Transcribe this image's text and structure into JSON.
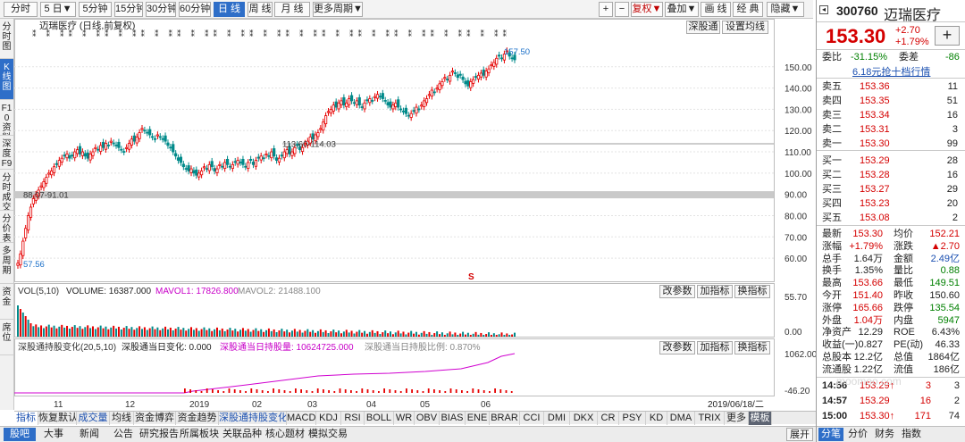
{
  "toolbar": {
    "periods": [
      "分时",
      "5 日▼",
      "5分钟",
      "15分钟",
      "30分钟",
      "60分钟",
      "日 线",
      "周 线",
      "月 线",
      "更多周期▼"
    ],
    "active_period": "日 线",
    "right_buttons": [
      "+",
      "−",
      "复权▼",
      "叠加▼",
      "画 线",
      "经 典",
      "隐藏▼"
    ]
  },
  "left_tabs": [
    "分时图",
    "K线图",
    "F10资料",
    "深度F9",
    "分时成交",
    "分价表",
    "多周期",
    "资金",
    "席位"
  ],
  "chart_header": {
    "title": "迈瑞医疗 (日线,前复权)",
    "sgt_btn": "深股通",
    "ma_btn": "设置均线"
  },
  "chart_data": [
    {
      "type": "candlestick",
      "title": "迈瑞医疗 (日线,前复权)",
      "y_ticks": [
        "150.00",
        "140.00",
        "130.00",
        "120.00",
        "110.00",
        "100.00",
        "90.00",
        "80.00",
        "70.00",
        "60.00"
      ],
      "ylim": [
        55,
        160
      ],
      "x_ticks": [
        "11",
        "12",
        "2019",
        "02",
        "03",
        "04",
        "05",
        "06"
      ],
      "annotations": [
        {
          "text": "157.50",
          "value": 157.5
        },
        {
          "text": "113.60-114.03",
          "value": 114
        },
        {
          "text": "88.07-91.01",
          "value": 90
        },
        {
          "text": "57.56",
          "value": 57.56
        }
      ],
      "close_approx": [
        57.6,
        62,
        68,
        74,
        80,
        84,
        88,
        90,
        92,
        94,
        96,
        98,
        100,
        101,
        103,
        104,
        106,
        107,
        108,
        109,
        107,
        108,
        110,
        111,
        109,
        110,
        108,
        107,
        109,
        110,
        112,
        111,
        113,
        112,
        114,
        113,
        115,
        114,
        113,
        112,
        111,
        110,
        112,
        114,
        116,
        115,
        117,
        119,
        121,
        120,
        119,
        118,
        117,
        116,
        118,
        117,
        116,
        115,
        113,
        112,
        110,
        108,
        106,
        105,
        103,
        102,
        101,
        102,
        100,
        99,
        100,
        101,
        103,
        102,
        104,
        103,
        101,
        102,
        104,
        103,
        105,
        104,
        103,
        104,
        105,
        106,
        105,
        104,
        103,
        105,
        106,
        104,
        106,
        107,
        108,
        107,
        109,
        108,
        110,
        108,
        106,
        107,
        108,
        110,
        111,
        109,
        110,
        112,
        113,
        111,
        112,
        114,
        115,
        117,
        116,
        118,
        119,
        121,
        124,
        127,
        129,
        130,
        132,
        131,
        133,
        134,
        132,
        133,
        135,
        134,
        133,
        134,
        132,
        131,
        133,
        134,
        135,
        134,
        136,
        137,
        136,
        135,
        134,
        132,
        131,
        132,
        133,
        131,
        130,
        129,
        128,
        127,
        128,
        129,
        131,
        130,
        132,
        134,
        135,
        137,
        139,
        138,
        140,
        142,
        143,
        145,
        144,
        146,
        148,
        147,
        145,
        146,
        144,
        142,
        141,
        143,
        144,
        145,
        146,
        147,
        146,
        148,
        149,
        151,
        152,
        154,
        155,
        154,
        156,
        157.5,
        155,
        154,
        153.3
      ]
    },
    {
      "type": "bar",
      "title": "VOL(5,10)",
      "legend": [
        "VOLUME: 16387.000",
        "MAVOL1: 17826.800",
        "MAVOL2: 21488.100"
      ],
      "y_ticks": [
        "55.70",
        "0.00"
      ],
      "ylim": [
        0,
        60
      ]
    },
    {
      "type": "line",
      "title": "深股通持股变化(20,5,10)",
      "legend": [
        "深股通当日变化: 0.000",
        "深股通当日持股量: 10624725.000",
        "深股通当日持股比例: 0.870%"
      ],
      "y_ticks": [
        "1062.00",
        "-46.20"
      ],
      "ylim": [
        -46.2,
        1062
      ]
    }
  ],
  "vol_buttons": [
    "改参数",
    "加指标",
    "换指标"
  ],
  "sgt_buttons": [
    "改参数",
    "加指标",
    "换指标"
  ],
  "date_label": "2019/06/18/二",
  "s_marker": "S",
  "bottom_tabs": [
    "指标",
    "恢复默认",
    "成交量",
    "均线",
    "资金博弈",
    "资金趋势",
    "深股通持股变化",
    "MACD",
    "KDJ",
    "RSI",
    "BOLL",
    "WR",
    "OBV",
    "BIAS",
    "ENE",
    "BRAR",
    "CCI",
    "DMI",
    "DKX",
    "CR",
    "PSY",
    "KD",
    "DMA",
    "TRIX",
    "更多",
    "模板"
  ],
  "bottom_bar": [
    "股吧",
    "大事",
    "新闻",
    "公告",
    "研究报告",
    "所属板块",
    "关联品种",
    "核心题材",
    "模拟交易"
  ],
  "expand_btn": "展开",
  "quote": {
    "code": "300760",
    "name": "迈瑞医疗",
    "price": "153.30",
    "change": "+2.70",
    "change_pct": "+1.79%",
    "weibi_label": "委比",
    "weibi": "-31.15%",
    "weicha_label": "委差",
    "weicha": "-86",
    "promo": "6.18元抢十档行情",
    "sell": [
      {
        "label": "卖五",
        "price": "153.36",
        "vol": "11"
      },
      {
        "label": "卖四",
        "price": "153.35",
        "vol": "51"
      },
      {
        "label": "卖三",
        "price": "153.34",
        "vol": "16"
      },
      {
        "label": "卖二",
        "price": "153.31",
        "vol": "3"
      },
      {
        "label": "卖一",
        "price": "153.30",
        "vol": "99"
      }
    ],
    "buy": [
      {
        "label": "买一",
        "price": "153.29",
        "vol": "28"
      },
      {
        "label": "买二",
        "price": "153.28",
        "vol": "16"
      },
      {
        "label": "买三",
        "price": "153.27",
        "vol": "29"
      },
      {
        "label": "买四",
        "price": "153.23",
        "vol": "20"
      },
      {
        "label": "买五",
        "price": "153.08",
        "vol": "2"
      }
    ],
    "stats": [
      {
        "l1": "最新",
        "v1": "153.30",
        "c1": "r",
        "l2": "均价",
        "v2": "152.21",
        "c2": "r"
      },
      {
        "l1": "涨幅",
        "v1": "+1.79%",
        "c1": "r",
        "l2": "涨跌",
        "v2": "▲2.70",
        "c2": "r"
      },
      {
        "l1": "总手",
        "v1": "1.64万",
        "c1": "k",
        "l2": "金额",
        "v2": "2.49亿",
        "c2": "b"
      },
      {
        "l1": "换手",
        "v1": "1.35%",
        "c1": "k",
        "l2": "量比",
        "v2": "0.88",
        "c2": "g"
      },
      {
        "l1": "最高",
        "v1": "153.66",
        "c1": "r",
        "l2": "最低",
        "v2": "149.51",
        "c2": "g"
      },
      {
        "l1": "今开",
        "v1": "151.40",
        "c1": "r",
        "l2": "昨收",
        "v2": "150.60",
        "c2": "k"
      },
      {
        "l1": "涨停",
        "v1": "165.66",
        "c1": "r",
        "l2": "跌停",
        "v2": "135.54",
        "c2": "g"
      },
      {
        "l1": "外盘",
        "v1": "1.04万",
        "c1": "r",
        "l2": "内盘",
        "v2": "5947",
        "c2": "g"
      },
      {
        "l1": "净资产",
        "v1": "12.29",
        "c1": "k",
        "l2": "ROE",
        "v2": "6.43%",
        "c2": "k"
      },
      {
        "l1": "收益(一)",
        "v1": "0.827",
        "c1": "k",
        "l2": "PE(动)",
        "v2": "46.33",
        "c2": "k"
      },
      {
        "l1": "总股本",
        "v1": "12.2亿",
        "c1": "k",
        "l2": "总值",
        "v2": "1864亿",
        "c2": "k"
      },
      {
        "l1": "流通股",
        "v1": "1.22亿",
        "c1": "k",
        "l2": "流值",
        "v2": "186亿",
        "c2": "k"
      }
    ],
    "ticks": [
      {
        "time": "14:56",
        "price": "153.29↑",
        "vol": "3",
        "n": "3"
      },
      {
        "time": "14:57",
        "price": "153.29",
        "vol": "16",
        "n": "2"
      },
      {
        "time": "15:00",
        "price": "153.30↑",
        "vol": "171",
        "n": "74"
      }
    ],
    "bottom_tabs": [
      "分笔",
      "分价",
      "财务",
      "指数"
    ],
    "watermark": "moomoo.com"
  }
}
